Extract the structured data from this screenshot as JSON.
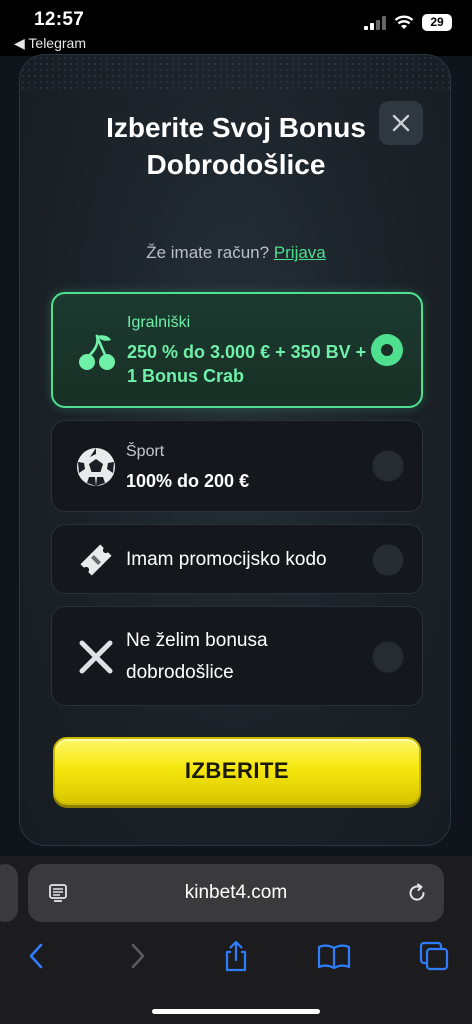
{
  "status_bar": {
    "time": "12:57",
    "back_app": "◀ Telegram",
    "battery": "29"
  },
  "modal": {
    "title": "Izberite Svoj Bonus Dobrodošlice",
    "login_prompt": "Že imate račun?",
    "login_link": "Prijava",
    "options": [
      {
        "label": "Igralniški",
        "value": "250 % do 3.000 € + 350 BV + 1 Bonus Crab",
        "icon": "cherry-icon",
        "selected": true
      },
      {
        "label": "Šport",
        "value": "100% do 200 €",
        "icon": "soccer-ball-icon",
        "selected": false
      },
      {
        "text": "Imam promocijsko kodo",
        "icon": "ticket-icon",
        "selected": false
      },
      {
        "text": "Ne želim bonusa dobrodošlice",
        "icon": "cross-icon",
        "selected": false
      }
    ],
    "submit_label": "IZBERITE"
  },
  "browser": {
    "url": "kinbet4.com"
  },
  "colors": {
    "accent_green": "#4fe08f",
    "cta_yellow": "#f6e80e",
    "modal_bg": "#1b2228"
  }
}
